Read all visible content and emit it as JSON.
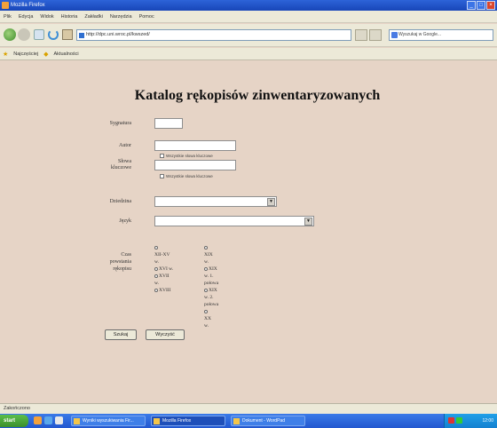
{
  "window": {
    "title": "Mozilla Firefox"
  },
  "menu": [
    "Plik",
    "Edycja",
    "Widok",
    "Historia",
    "Zakładki",
    "Narzędzia",
    "Pomoc"
  ],
  "nav": {
    "address": "http://dpc.uni.wroc.pl/kwszed/",
    "search_placeholder": "Wyszukaj w Google..."
  },
  "favorites": {
    "item1": "Najczęściej",
    "item2": "Aktualności"
  },
  "page": {
    "title": "Katalog rękopisów zinwentaryzowanych",
    "form": {
      "sygnatura_label": "Sygnatura",
      "autor_label": "Autor",
      "slowa_label1": "Słowa",
      "slowa_label2": "kluczowe",
      "option_all": "Wszystkie słowa kluczowe",
      "option_any": "Wszystkie słowa kluczowe",
      "dziedzina_label": "Dziedzina",
      "jezyk_label": "Język",
      "czas_label1": "Czas",
      "czas_label2": "powstania",
      "czas_label3": "rękopisu",
      "submit_label": "Szukaj",
      "reset_label": "Wyczyść"
    },
    "time_col1": [
      "XII-XV",
      "w.",
      "XVI w.",
      "XVII",
      "w.",
      "XVIII"
    ],
    "time_col2": [
      "XIX",
      "w.",
      "XIX",
      "w. 1.",
      "połowa",
      "XIX",
      "w. 2.",
      "połowa",
      "XX",
      "w."
    ]
  },
  "status": {
    "text": "Zakończono"
  },
  "taskbar": {
    "start_label": "start",
    "tasks": [
      "Wyniki wyszukiwania Fir...",
      "Mozilla Firefox",
      "Dokument - WordPad"
    ],
    "clock": "12:00"
  }
}
